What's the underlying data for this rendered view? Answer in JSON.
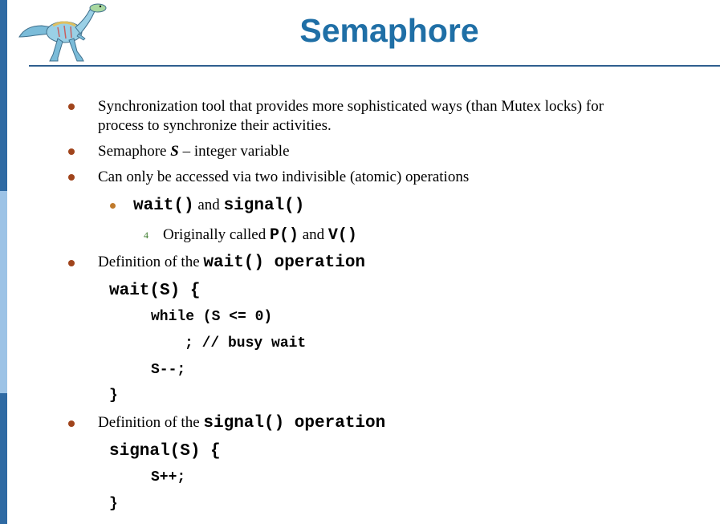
{
  "slide": {
    "title": "Semaphore",
    "colors": {
      "title": "#1f6fa6",
      "bullet": "#a0441c",
      "sub_bullet": "#c07a2c",
      "number": "#3a7a2a",
      "sidebar_dark": "#2f6aa3",
      "sidebar_light": "#9dc3e6"
    },
    "logo_icon": "dinosaur-logo"
  },
  "bullets": {
    "b1_line1": "Synchronization tool that provides more sophisticated ways (than Mutex locks)  for",
    "b1_line2": "process to synchronize their activities.",
    "b2_pre": "Semaphore ",
    "b2_var": "S",
    "b2_post": " – integer variable",
    "b3": "Can only be accessed via two indivisible (atomic) operations",
    "sub1_code1": "wait()",
    "sub1_mid": " and ",
    "sub1_code2": "signal()",
    "sub2_num": "4",
    "sub2_pre": "Originally called ",
    "sub2_code1": "P()",
    "sub2_mid": " and ",
    "sub2_code2": "V()",
    "b4_pre": "Definition of  the ",
    "b4_code": "wait() operation",
    "b5_pre": "Definition of  the ",
    "b5_code": "signal() operation"
  },
  "code": {
    "wait_header": "wait(S) {",
    "wait_line1": "while (S <= 0)",
    "wait_line2": "; // busy wait",
    "wait_line3": "S--;",
    "wait_close": "}",
    "signal_header": "signal(S) {",
    "signal_line1": "S++;",
    "signal_close": "}"
  }
}
